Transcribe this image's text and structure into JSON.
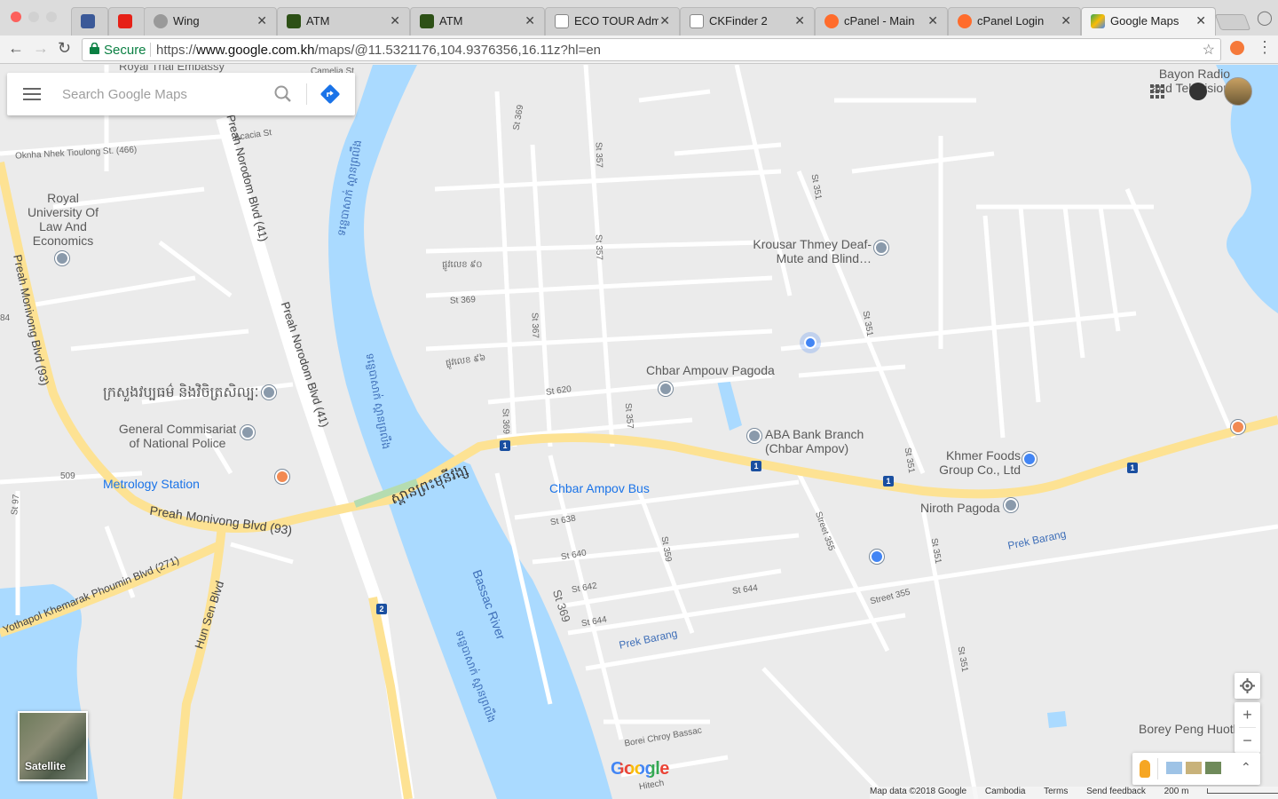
{
  "browser": {
    "tabs": [
      {
        "title": "",
        "favicon": "facebook",
        "color": "#3b5998"
      },
      {
        "title": "",
        "favicon": "youtube",
        "color": "#e62117"
      },
      {
        "title": "Wing",
        "favicon": "wing",
        "color": "#888888"
      },
      {
        "title": "ATM",
        "favicon": "atm",
        "color": "#2d5016"
      },
      {
        "title": "ATM",
        "favicon": "atm",
        "color": "#2d5016"
      },
      {
        "title": "ECO TOUR Adm",
        "favicon": "page",
        "color": "#ffffff"
      },
      {
        "title": "CKFinder 2",
        "favicon": "page",
        "color": "#ffffff"
      },
      {
        "title": "cPanel - Main",
        "favicon": "cpanel",
        "color": "#ff6c2c"
      },
      {
        "title": "cPanel Login",
        "favicon": "cpanel",
        "color": "#ff6c2c"
      },
      {
        "title": "Google Maps",
        "favicon": "maps",
        "color": "#34a853",
        "active": true
      }
    ],
    "address": {
      "secure_label": "Secure",
      "scheme": "https://",
      "host": "www.google.com.kh",
      "path": "/maps/@11.5321176,104.9376356,16.11z?hl=en"
    }
  },
  "search": {
    "placeholder": "Search Google Maps"
  },
  "map": {
    "colors": {
      "land": "#ebebeb",
      "water": "#aadaff",
      "major_road": "#fde293",
      "minor_road": "#ffffff",
      "poi_blue": "#1a73e8"
    },
    "places": {
      "royal_thai": "Royal Thai Embassy",
      "camelia": "Camelia St",
      "acacia": "Acacia St",
      "oknha": "Oknha Nhek Tioulong St. (466)",
      "royal_univ": "Royal University Of Law And Economics",
      "ministry_kh": "ក្រសួងវប្បធម៌ និងវិចិត្រសិល្បៈ",
      "commissariat": "General Commisariat of National Police",
      "metrology": "Metrology Station",
      "krousar": "Krousar Thmey Deaf-Mute and Blind…",
      "chbar_pagoda": "Chbar Ampouv Pagoda",
      "aba": "ABA Bank Branch (Chbar Ampov)",
      "chbar_bus": "Chbar Ampov Bus",
      "khmer_foods": "Khmer Foods Group Co., Ltd",
      "niroth": "Niroth Pagoda",
      "bayon": "Bayon Radio and Television",
      "borey": "Borey Peng Huoth",
      "prek_barang_1": "Prek Barang",
      "prek_barang_2": "Prek Barang",
      "bassac": "Bassac River",
      "bridge_kh": "ស្ពានព្រះមុនីវង្ស",
      "river_kh": "ទន្លេបាសាក់ ស្ពានព្រលឹង",
      "borei_chroy": "Borei Chroy Bassac",
      "hitech": "Hitech"
    },
    "roads": {
      "norodom_1": "Preah Norodom Blvd (41)",
      "norodom_2": "Preah Norodom Blvd (41)",
      "monivong_1": "Preah Monivong Blvd (93)",
      "monivong_2": "Preah Monivong Blvd (93)",
      "yothapol": "Yothapol Khemarak Phoumin Blvd (271)",
      "hunsen": "Hun Sen Blvd",
      "st369_a": "St 369",
      "st369_b": "St 369",
      "st369_c": "St 369",
      "st369_d": "St 369",
      "st357_a": "St 357",
      "st357_b": "St 357",
      "st357_c": "St 357",
      "st367": "St 367",
      "st351_a": "St 351",
      "st351_b": "St 351",
      "st351_c": "St 351",
      "st351_d": "St 351",
      "st351_e": "St 351",
      "st620": "St 620",
      "st638": "St 638",
      "st640": "St 640",
      "st642": "St 642",
      "st644_a": "St 644",
      "st644_b": "St 644",
      "st359": "St 359",
      "street355_a": "Street 355",
      "street355_b": "Street 355",
      "st509": "509",
      "st97": "St 97",
      "kh_90": "ផ្លូវលេខ ៩០",
      "kh_96": "ផ្លូវលេខ ៩៦",
      "edge84": "84"
    },
    "shields": [
      "1",
      "1",
      "1",
      "1",
      "1",
      "2"
    ]
  },
  "controls": {
    "satellite_label": "Satellite",
    "google_logo": "Google",
    "zoom_in": "+",
    "zoom_out": "−"
  },
  "footer": {
    "map_data": "Map data ©2018 Google",
    "region": "Cambodia",
    "terms": "Terms",
    "feedback": "Send feedback",
    "scale": "200 m"
  }
}
